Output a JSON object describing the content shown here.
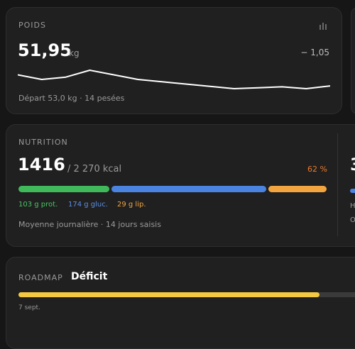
{
  "poids": {
    "title": "POIDS",
    "value": "51,95",
    "unit": "kg",
    "delta": "− 1,05",
    "footer": "Départ 53,0 kg · 14 pesées",
    "icon": "bar-chart-icon",
    "sparkline": [
      53.0,
      52.9,
      52.95,
      53.1,
      53.0,
      52.9,
      52.85,
      52.8,
      52.75,
      52.7,
      52.72,
      52.74,
      52.7,
      52.76
    ]
  },
  "nutrition": {
    "title": "NUTRITION",
    "value": "1416",
    "target": "/ 2 270 kcal",
    "percent": "62 %",
    "protein": "103 g prot.",
    "glucides": "174 g gluc.",
    "lipides": "29 g lip.",
    "footer": "Moyenne journalière · 14 jours saisis",
    "side_value": "3",
    "side_line1": "H",
    "side_line2": "O",
    "colors": {
      "protein": "#3fb95a",
      "glucides": "#4b83e0",
      "lipides": "#f2a53e",
      "percent": "#f07a2a"
    }
  },
  "roadmap": {
    "title": "ROADMAP",
    "subtitle": "Déficit",
    "date": "7 sept.",
    "progress": 0.865,
    "color": "#f4c840"
  }
}
